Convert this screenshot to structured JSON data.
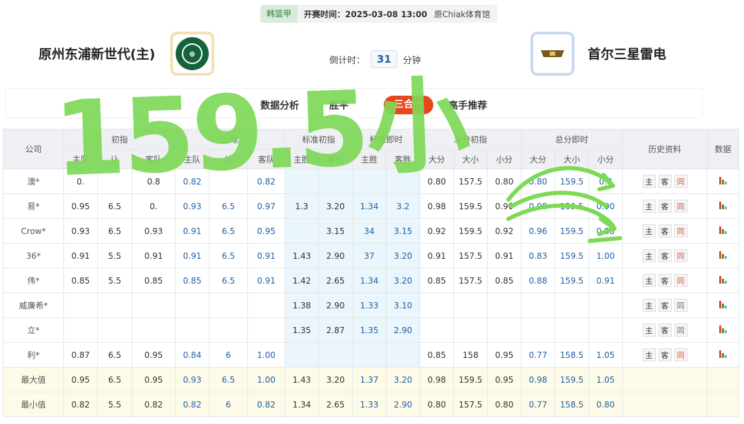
{
  "match": {
    "league": "韩篮甲",
    "start_time": "开赛时间：2025-03-08 13:00",
    "venue": "原Chiak体育馆",
    "home": "原州东浦新世代(主)",
    "away": "首尔三星雷电",
    "countdown_label": "倒计时：",
    "countdown_value": "31",
    "countdown_unit": "分钟"
  },
  "tabs": [
    {
      "label": "数据分析",
      "active": false
    },
    {
      "label": "胜平",
      "active": false
    },
    {
      "label": "三合一",
      "active": true
    },
    {
      "label": "高手推荐",
      "active": false
    }
  ],
  "table": {
    "headers": {
      "company": "公司",
      "groups": [
        "初指",
        "让球",
        "标准初指",
        "标准即时",
        "总分初指",
        "总分即时",
        "历史资料",
        "数据"
      ],
      "sub": [
        "主队",
        "让",
        "客队",
        "主队",
        "让",
        "客队",
        "主胜",
        "客胜",
        "主胜",
        "客胜",
        "大分",
        "大小",
        "小分",
        "大分",
        "大小",
        "小分"
      ]
    },
    "rows": [
      {
        "co": "澳*",
        "c": [
          "0.",
          "",
          "0.8",
          "0.82",
          "",
          "0.82",
          "",
          "",
          "",
          "",
          "0.80",
          "157.5",
          "0.80",
          "0.80",
          "159.5",
          "0.8"
        ],
        "tong": true
      },
      {
        "co": "易*",
        "c": [
          "0.95",
          "6.5",
          "0.",
          "0.93",
          "6.5",
          "0.97",
          "1.3",
          "3.20",
          "1.34",
          "3.2",
          "0.98",
          "159.5",
          "0.90",
          "0.98",
          "159.5",
          "0.90"
        ],
        "tong": true
      },
      {
        "co": "Crow*",
        "c": [
          "0.93",
          "6.5",
          "0.93",
          "0.91",
          "6.5",
          "0.95",
          "",
          "3.15",
          "34",
          "3.15",
          "0.92",
          "159.5",
          "0.92",
          "0.96",
          "159.5",
          "0.88"
        ],
        "tong": true
      },
      {
        "co": "36*",
        "c": [
          "0.91",
          "5.5",
          "0.91",
          "0.91",
          "6.5",
          "0.91",
          "1.43",
          "2.90",
          "37",
          "3.20",
          "0.91",
          "157.5",
          "0.91",
          "0.83",
          "159.5",
          "1.00"
        ],
        "tong": true
      },
      {
        "co": "伟*",
        "c": [
          "0.85",
          "5.5",
          "0.85",
          "0.85",
          "6.5",
          "0.91",
          "1.42",
          "2.65",
          "1.34",
          "3.20",
          "0.85",
          "157.5",
          "0.85",
          "0.88",
          "159.5",
          "0.91"
        ],
        "tong": true
      },
      {
        "co": "威廉希*",
        "c": [
          "",
          "",
          "",
          "",
          "",
          "",
          "1.38",
          "2.90",
          "1.33",
          "3.10",
          "",
          "",
          "",
          "",
          "",
          ""
        ],
        "tong": false
      },
      {
        "co": "立*",
        "c": [
          "",
          "",
          "",
          "",
          "",
          "",
          "1.35",
          "2.87",
          "1.35",
          "2.90",
          "",
          "",
          "",
          "",
          "",
          ""
        ],
        "tong": false
      },
      {
        "co": "利*",
        "c": [
          "0.87",
          "6.5",
          "0.95",
          "0.84",
          "6",
          "1.00",
          "",
          "",
          "",
          "",
          "0.85",
          "158",
          "0.95",
          "0.77",
          "158.5",
          "1.05"
        ],
        "tong": true
      }
    ],
    "summary": [
      {
        "co": "最大值",
        "c": [
          "0.95",
          "6.5",
          "0.95",
          "0.93",
          "6.5",
          "1.00",
          "1.43",
          "3.20",
          "1.37",
          "3.20",
          "0.98",
          "159.5",
          "0.95",
          "0.98",
          "159.5",
          "1.05"
        ]
      },
      {
        "co": "最小值",
        "c": [
          "0.82",
          "5.5",
          "0.82",
          "0.82",
          "6",
          "0.82",
          "1.34",
          "2.65",
          "1.33",
          "2.90",
          "0.80",
          "157.5",
          "0.80",
          "0.77",
          "158.5",
          "0.80"
        ]
      }
    ],
    "history_buttons": [
      "主",
      "客",
      "同"
    ]
  },
  "handwriting": {
    "text": "159.5小",
    "color": "#7ed957"
  }
}
